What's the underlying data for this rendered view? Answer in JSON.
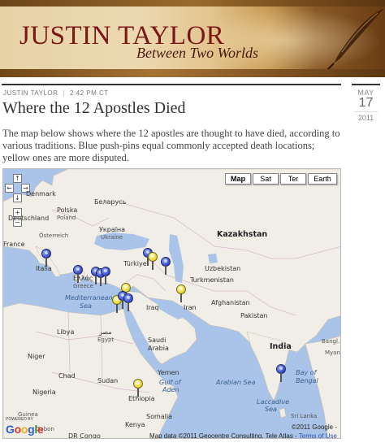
{
  "header": {
    "title": "JUSTIN TAYLOR",
    "subtitle": "Between Two Worlds"
  },
  "post": {
    "author": "JUSTIN TAYLOR",
    "time": "2:42 PM CT",
    "date": {
      "month": "MAY",
      "day": "17",
      "year": "2011"
    },
    "title": "Where the 12 Apostles Died",
    "body": "The map below shows where the 12 apostles are thought to have died, according to various traditions. Blue push-pins equal commonly accepted death locations; yellow ones are more disputed."
  },
  "map": {
    "map_types": [
      "Map",
      "Sat",
      "Ter",
      "Earth"
    ],
    "active_type": "Map",
    "nav_controls": [
      "↑",
      "←",
      "→",
      "↓",
      "+",
      "−"
    ],
    "colors": {
      "water": "#a9c4e8",
      "land": "#f1eee8",
      "blue_pin": "#3348c6",
      "yellow_pin": "#e7d42a"
    },
    "labels": {
      "Denmark": "Denmark",
      "Belarus": "Беларусь",
      "Poland": "Polska",
      "Poland_en": "Poland",
      "Ukraine": "Україна",
      "Ukraine_en": "Ukraine",
      "Germany": "Deutschland",
      "Austria": "Österreich",
      "France": "France",
      "Italy": "Italia",
      "Greece": "Ελλάς",
      "Greece_en": "Greece",
      "Turkey": "Türkiye",
      "Kazakhstan": "Kazakhstan",
      "Uzbekistan": "Uzbekistan",
      "Turkmenistan": "Turkmenistan",
      "Afghanistan": "Afghanistan",
      "Iraq": "Iraq",
      "Iran": "Iran",
      "Mediterranean_Sea": "Mediterranean",
      "Mediterranean_Sea2": "Sea",
      "Libya": "Libya",
      "Egypt_ar": "مصر",
      "Egypt": "Egypt",
      "Saudi_Arabia": "Saudi",
      "Saudi_Arabia2": "Arabia",
      "Pakistan": "Pakistan",
      "India": "India",
      "Niger": "Niger",
      "Chad": "Chad",
      "Sudan": "Sudan",
      "Yemen": "Yemen",
      "Gulf_of_Aden": "Gulf of",
      "Gulf_of_Aden2": "Aden",
      "Arabian_Sea": "Arabian Sea",
      "Bay_of_Bengal": "Bay of",
      "Bay_of_Bengal2": "Bengal",
      "Ethiopia": "Ethiopia",
      "Somalia": "Somalia",
      "Kenya": "Kenya",
      "Nigeria": "Nigeria",
      "Guinea": "Guinea",
      "Gabon": "Gabon",
      "DR_Congo": "DR Congo",
      "Laccadive_Sea": "Laccadive",
      "Laccadive_Sea2": "Sea",
      "Sri_Lanka": "Sri Lanka",
      "Bangladesh": "Bangl...",
      "Myanmar": "Myanm..."
    },
    "pins": [
      {
        "name": "rome",
        "color": "blue"
      },
      {
        "name": "greece-1",
        "color": "blue"
      },
      {
        "name": "greece-2",
        "color": "blue"
      },
      {
        "name": "asia-minor-1",
        "color": "blue"
      },
      {
        "name": "asia-minor-2",
        "color": "blue"
      },
      {
        "name": "armenia-1",
        "color": "blue"
      },
      {
        "name": "armenia-2",
        "color": "yellow"
      },
      {
        "name": "armenia-3",
        "color": "blue"
      },
      {
        "name": "syria",
        "color": "yellow"
      },
      {
        "name": "jerusalem-1",
        "color": "yellow"
      },
      {
        "name": "jerusalem-2",
        "color": "blue"
      },
      {
        "name": "jerusalem-3",
        "color": "blue"
      },
      {
        "name": "persia",
        "color": "yellow"
      },
      {
        "name": "india",
        "color": "blue"
      },
      {
        "name": "ethiopia",
        "color": "yellow"
      }
    ],
    "powered_by": "POWERED BY",
    "google_logo": "Google",
    "copyright": "©2011 Google -",
    "attribution": "Map data ©2011 Geocentre Consulting, Tele Atlas -",
    "terms_link": "Terms of Use"
  }
}
